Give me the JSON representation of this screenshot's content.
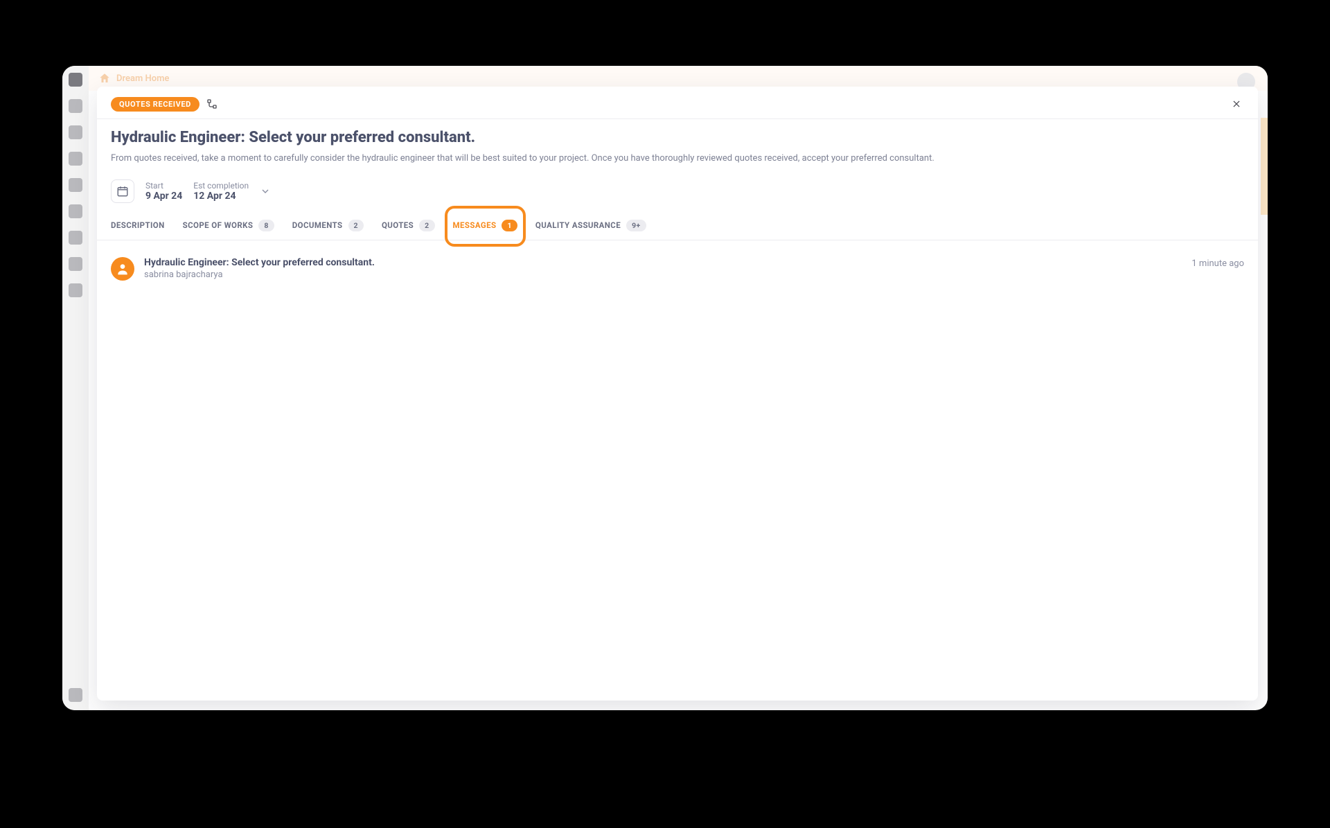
{
  "background": {
    "project_name": "Dream Home"
  },
  "modal": {
    "status_pill": "QUOTES RECEIVED",
    "title": "Hydraulic Engineer: Select your preferred consultant.",
    "subtitle": "From quotes received, take a moment to carefully consider the hydraulic engineer that will be best suited to your project. Once you have thoroughly reviewed quotes received, accept your preferred consultant.",
    "dates": {
      "start_label": "Start",
      "start_value": "9 Apr 24",
      "est_label": "Est completion",
      "est_value": "12 Apr 24"
    },
    "tabs": {
      "description": "DESCRIPTION",
      "scope": "SCOPE OF WORKS",
      "scope_badge": "8",
      "documents": "DOCUMENTS",
      "documents_badge": "2",
      "quotes": "QUOTES",
      "quotes_badge": "2",
      "messages": "MESSAGES",
      "messages_badge": "1",
      "qa": "QUALITY ASSURANCE",
      "qa_badge": "9+"
    },
    "messages": [
      {
        "title": "Hydraulic Engineer: Select your preferred consultant.",
        "author": "sabrina bajracharya",
        "time": "1 minute ago"
      }
    ]
  }
}
